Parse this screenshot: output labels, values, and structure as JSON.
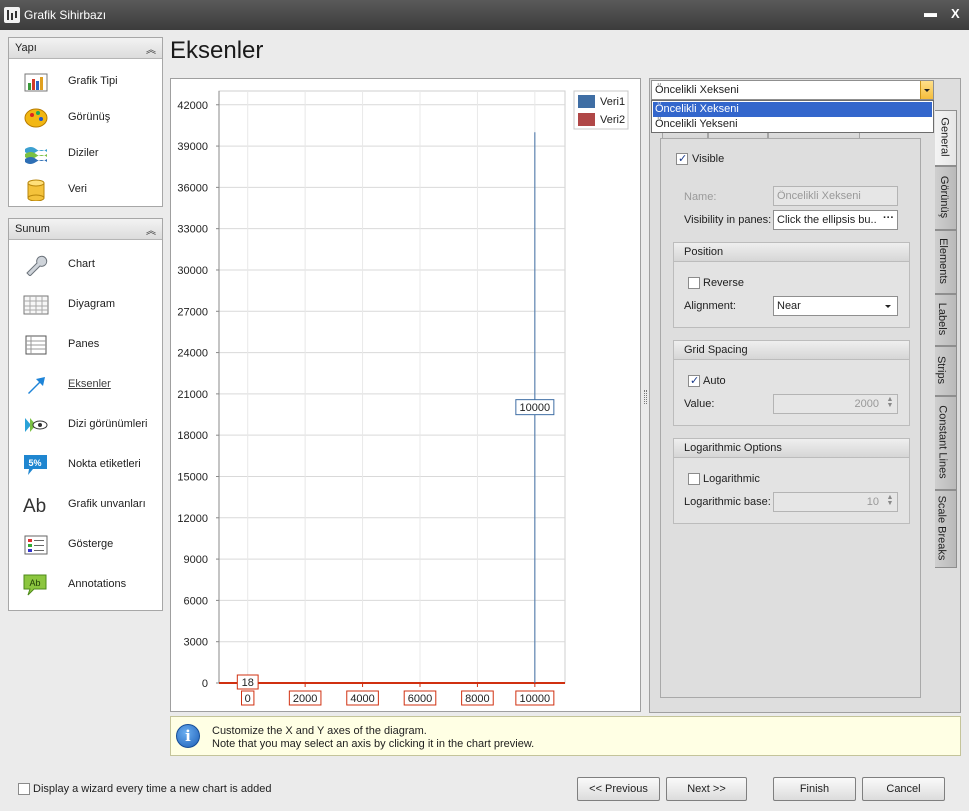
{
  "window": {
    "title": "Grafik Sihirbazı"
  },
  "sidebar": {
    "yapi": {
      "header": "Yapı",
      "items": [
        {
          "label": "Grafik Tipi",
          "icon": "bar-chart-icon"
        },
        {
          "label": "Görünüş",
          "icon": "palette-icon"
        },
        {
          "label": "Diziler",
          "icon": "series-layers-icon"
        },
        {
          "label": "Veri",
          "icon": "database-icon"
        }
      ]
    },
    "sunum": {
      "header": "Sunum",
      "items": [
        {
          "label": "Chart",
          "icon": "wrench-icon"
        },
        {
          "label": "Diyagram",
          "icon": "grid-icon"
        },
        {
          "label": "Panes",
          "icon": "panes-icon"
        },
        {
          "label": "Eksenler",
          "icon": "axis-arrow-icon",
          "selected": true
        },
        {
          "label": "Dizi görünümleri",
          "icon": "series-view-icon"
        },
        {
          "label": "Nokta etiketleri",
          "icon": "point-label-icon"
        },
        {
          "label": "Grafik unvanları",
          "icon": "text-ab-icon"
        },
        {
          "label": "Gösterge",
          "icon": "legend-icon"
        },
        {
          "label": "Annotations",
          "icon": "annotation-icon"
        }
      ],
      "point_label_badge": "5%",
      "ab_glyph": "Ab",
      "annotation_glyph": "Ab"
    }
  },
  "page": {
    "title": "Eksenler"
  },
  "chart_data": {
    "type": "bar",
    "x_ticks": [
      0,
      2000,
      4000,
      6000,
      8000,
      10000
    ],
    "y_ticks": [
      0,
      3000,
      6000,
      9000,
      12000,
      15000,
      18000,
      21000,
      24000,
      27000,
      30000,
      33000,
      36000,
      39000,
      42000
    ],
    "xlim": [
      -1000,
      11050
    ],
    "ylim": [
      0,
      43000
    ],
    "series": [
      {
        "name": "Veri1",
        "color": "#3f6ea4",
        "points": [
          {
            "x": 10000,
            "y": 40000
          }
        ]
      },
      {
        "name": "Veri2",
        "color": "#b04747",
        "points": [
          {
            "x": 0,
            "y": 18
          }
        ]
      }
    ],
    "data_labels": [
      {
        "x": 10000,
        "y": 20000,
        "text": "10000"
      }
    ],
    "axis_labels": [
      {
        "x": 0,
        "text": "18"
      }
    ],
    "grid": true,
    "legend_position": "top-right",
    "x_axis_color": "#d03010"
  },
  "axis_selector": {
    "value": "Öncelikli Xekseni",
    "options": [
      "Öncelikli Xekseni",
      "Öncelikli Yekseni"
    ],
    "selected_index": 0
  },
  "vtabs": [
    "General",
    "Görünüş",
    "Elements",
    "Labels",
    "Strips",
    "Constant Lines",
    "Scale Breaks"
  ],
  "general": {
    "visible_label": "Visible",
    "name_label": "Name:",
    "name_value": "Öncelikli Xekseni",
    "visibility_label": "Visibility in panes:",
    "visibility_value": "Click the ellipsis bu...",
    "ellipsis": "···",
    "position": {
      "header": "Position",
      "reverse_label": "Reverse",
      "alignment_label": "Alignment:",
      "alignment_value": "Near"
    },
    "grid_spacing": {
      "header": "Grid Spacing",
      "auto_label": "Auto",
      "value_label": "Value:",
      "value": "2000"
    },
    "logarithmic": {
      "header": "Logarithmic Options",
      "log_label": "Logarithmic",
      "base_label": "Logarithmic base:",
      "base_value": "10"
    }
  },
  "info": {
    "line1": "Customize the X and Y axes of the diagram.",
    "line2": "Note that you may select an axis by clicking it in the chart preview."
  },
  "footer": {
    "wizard_checkbox": "Display a wizard every time a new chart is added",
    "previous": "<< Previous",
    "next": "Next >>",
    "finish": "Finish",
    "cancel": "Cancel"
  }
}
